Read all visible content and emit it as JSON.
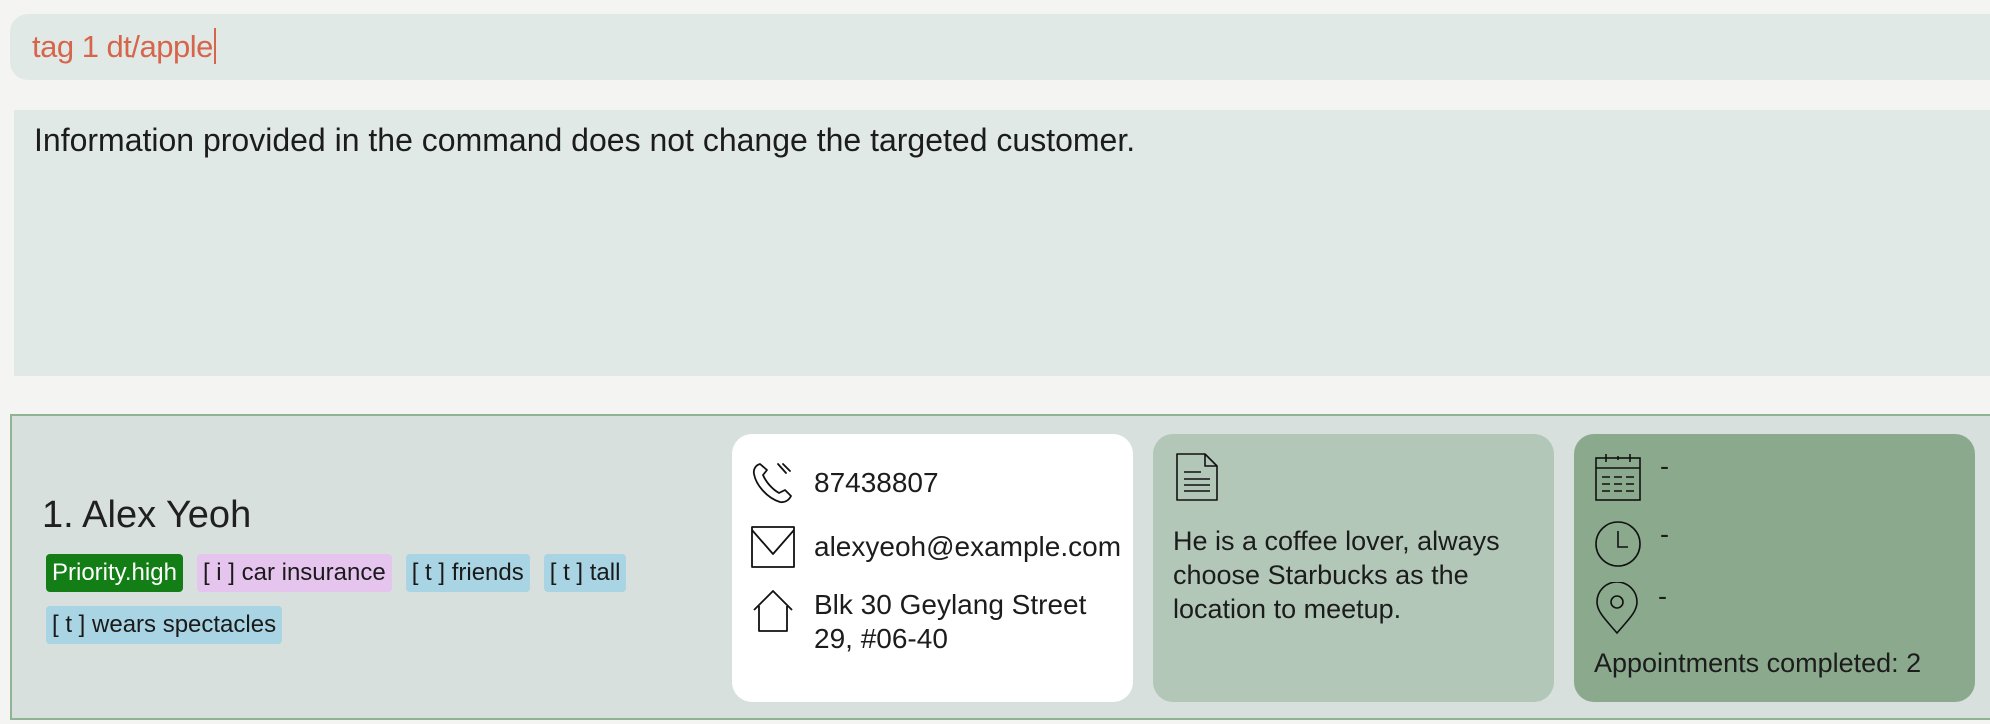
{
  "command_box": {
    "value": "tag 1 dt/apple"
  },
  "result_display": {
    "message": "Information provided in the command does not change the targeted customer."
  },
  "person": {
    "index_name": "1.  Alex Yeoh",
    "tags": [
      {
        "label": "Priority.high",
        "kind": "priority"
      },
      {
        "label": "[ i ] car insurance",
        "kind": "insurance"
      },
      {
        "label": "[ t ] friends",
        "kind": "plain"
      },
      {
        "label": "[ t ] tall",
        "kind": "plain"
      },
      {
        "label": "[ t ] wears spectacles",
        "kind": "plain"
      }
    ],
    "phone": "87438807",
    "email": "alexyeoh@example.com",
    "address": "Blk 30 Geylang Street 29, #06-40",
    "remark": "He is a coffee lover, always choose Starbucks as the location to meetup.",
    "appointment": {
      "date": "-",
      "time": "-",
      "location": "-",
      "completed": "Appointments completed: 2"
    }
  },
  "colors": {
    "command_text": "#d6654c",
    "priority_tag": "#127e15",
    "insurance_tag": "#e5c4ee",
    "plain_tag": "#a9d4e3",
    "remark_panel": "#b2c7b8",
    "appointment_panel": "#8aa98d"
  },
  "icons": [
    "phone-icon",
    "email-icon",
    "home-icon",
    "document-icon",
    "calendar-icon",
    "clock-icon",
    "location-icon"
  ]
}
